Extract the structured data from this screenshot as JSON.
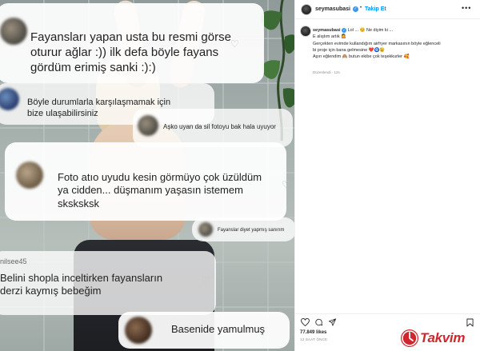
{
  "post": {
    "comments": [
      {
        "text": "Fayansları yapan usta bu resmi görse oturur ağlar :)) ilk defa böyle fayans gördüm erimiş sanki :):)"
      },
      {
        "text": "Böyle durumlarla karşılaşmamak için bize ulaşabilirsiniz"
      },
      {
        "text": "Aşko uyan da sil fotoyu bak hala uyuyor"
      },
      {
        "text": "Foto atıo uyudu kesin görmüyo çok üzüldüm ya cidden... düşmanım yaşasın istemem sksksksk"
      },
      {
        "text": "Fayanslar diyet yapmış sanırım"
      },
      {
        "username": "nilsee45",
        "text": "Belini shopla inceltirken fayansların derzi kaymış bebeğim"
      },
      {
        "text": "Basenide yamulmuş"
      }
    ]
  },
  "panel": {
    "username": "seymasubasi",
    "verified_mark": "✓",
    "separator": "•",
    "follow_label": "Takip Et",
    "more_label": "•••",
    "caption_lines": [
      "Lol ... 😊 Ne diyim ki ...",
      "E alıştım artık 🤷",
      "Gerçekten evimde kullandığım airfryer markasının böyle eğlenceli",
      "bi proje için bana gelmesine ❤️🧿😉",
      "Aşırı eğlendim 🙈 butun ekibe çok teşekkurler 🥰"
    ],
    "edited_label": "Düzenlendi · 12s",
    "likes": "77.849 likes",
    "time_ago": "12 SAAT ÖNCE"
  },
  "icons": {
    "like": "heart-icon",
    "comment": "comment-icon",
    "share": "share-icon",
    "save": "bookmark-icon",
    "comment_like": "heart-icon"
  },
  "watermark": {
    "text": "Takvim"
  },
  "colors": {
    "link_blue": "#0095f6",
    "verified_blue": "#3897f0",
    "watermark_red": "#d2262f",
    "muted": "#8e8e8e"
  }
}
